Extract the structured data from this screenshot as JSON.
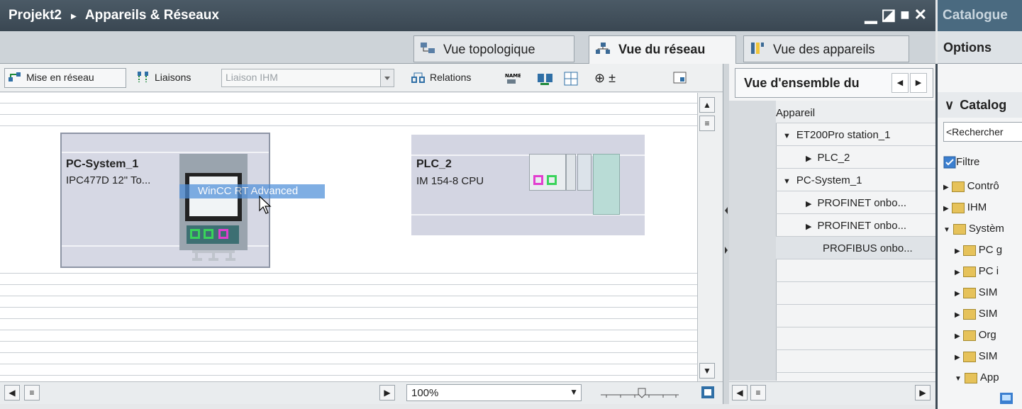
{
  "title": {
    "project": "Projekt2",
    "separator": "▸",
    "section": "Appareils & Réseaux"
  },
  "window_controls": {
    "minimize": "▁",
    "float": "◪",
    "maximize": "■",
    "close": "✕"
  },
  "catalog_title": "Catalogue",
  "view_tabs": [
    {
      "label": "Vue topologique",
      "icon": "topology-icon"
    },
    {
      "label": "Vue du réseau",
      "icon": "network-icon",
      "active": true
    },
    {
      "label": "Vue des appareils",
      "icon": "devices-icon"
    }
  ],
  "options_label": "Options",
  "toolbar": {
    "mise_en_reseau": "Mise en réseau",
    "liaisons": "Liaisons",
    "liaison_type": "Liaison IHM",
    "relations": "Relations",
    "zoom_label": "⊕ ±"
  },
  "devices": [
    {
      "name": "PC-System_1",
      "subtitle": "IPC477D 12\" To...",
      "tooltip": "WinCC RT Advanced"
    },
    {
      "name": "PLC_2",
      "subtitle": "IM 154-8 CPU"
    }
  ],
  "zoom": {
    "value": "100%",
    "arrow": "▼"
  },
  "overview": {
    "tab_label": "Vue d'ensemble du",
    "column_header": "Appareil",
    "rows": [
      {
        "label": "ET200Pro station_1",
        "toggle": "▼"
      },
      {
        "label": "PLC_2",
        "toggle": "▶"
      },
      {
        "label": "PC-System_1",
        "toggle": "▼"
      },
      {
        "label": "PROFINET onbo...",
        "toggle": "▶"
      },
      {
        "label": "PROFINET onbo...",
        "toggle": "▶"
      },
      {
        "label": "PROFIBUS onbo...",
        "toggle": ""
      }
    ]
  },
  "catalog": {
    "header": "Catalog",
    "header_toggle": "∨",
    "search_placeholder": "<Rechercher",
    "filter_label": "Filtre",
    "items": [
      {
        "label": "Contrô",
        "toggle": "▶",
        "level": 0
      },
      {
        "label": "IHM",
        "toggle": "▶",
        "level": 0
      },
      {
        "label": "Systèm",
        "toggle": "▼",
        "level": 0
      },
      {
        "label": "PC g",
        "toggle": "▶",
        "level": 1
      },
      {
        "label": "PC i",
        "toggle": "▶",
        "level": 1
      },
      {
        "label": "SIM",
        "toggle": "▶",
        "level": 1
      },
      {
        "label": "SIM",
        "toggle": "▶",
        "level": 1
      },
      {
        "label": "Org",
        "toggle": "▶",
        "level": 1
      },
      {
        "label": "SIM",
        "toggle": "▶",
        "level": 1
      },
      {
        "label": "App",
        "toggle": "▼",
        "level": 1
      }
    ]
  },
  "scroll": {
    "up": "▲",
    "down": "▼",
    "left": "◀",
    "right": "▶",
    "grip": "≡"
  }
}
